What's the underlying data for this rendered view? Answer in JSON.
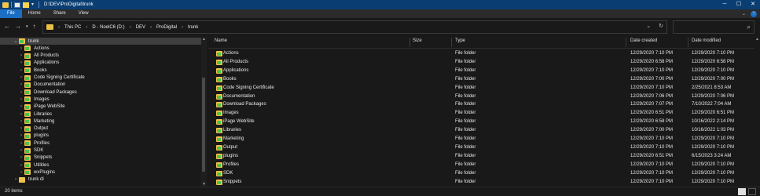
{
  "window": {
    "title": "D:\\DEV\\ProDigital\\trunk",
    "minimize": "─",
    "maximize": "☐",
    "close": "✕"
  },
  "ribbon": {
    "tabs": [
      "File",
      "Home",
      "Share",
      "View"
    ],
    "collapse_glyph": "⌄",
    "help_glyph": "?"
  },
  "address": {
    "crumbs": [
      "This PC",
      "D - NoelC6 (D:)",
      "DEV",
      "ProDigital",
      "trunk"
    ],
    "separator": "›",
    "search_placeholder": ""
  },
  "nav_tree": [
    {
      "label": "trunk",
      "indent": 0,
      "expanded": true,
      "selected": true
    },
    {
      "label": "Actions",
      "indent": 1
    },
    {
      "label": "All Products",
      "indent": 1
    },
    {
      "label": "Applications",
      "indent": 1
    },
    {
      "label": "Books",
      "indent": 1
    },
    {
      "label": "Code Signing Certificate",
      "indent": 1
    },
    {
      "label": "Documentation",
      "indent": 1
    },
    {
      "label": "Download Packages",
      "indent": 1
    },
    {
      "label": "Images",
      "indent": 1
    },
    {
      "label": "iPage WebSite",
      "indent": 1
    },
    {
      "label": "Libraries",
      "indent": 1
    },
    {
      "label": "Marketing",
      "indent": 1
    },
    {
      "label": "Output",
      "indent": 1
    },
    {
      "label": "plugins",
      "indent": 1
    },
    {
      "label": "Profiles",
      "indent": 1
    },
    {
      "label": "SDK",
      "indent": 1
    },
    {
      "label": "Snippets",
      "indent": 1
    },
    {
      "label": "Utilities",
      "indent": 1
    },
    {
      "label": "wxPlugins",
      "indent": 1
    },
    {
      "label": "trunk dl",
      "indent": 0,
      "plain": true
    }
  ],
  "columns": {
    "name": "Name",
    "size": "Size",
    "type": "Type",
    "created": "Date created",
    "modified": "Date modified"
  },
  "files": [
    {
      "name": "Actions",
      "type": "File folder",
      "created": "12/29/2020 7:10 PM",
      "modified": "12/29/2020 7:10 PM"
    },
    {
      "name": "All Products",
      "type": "File folder",
      "created": "12/29/2020 6:58 PM",
      "modified": "12/29/2020 6:58 PM"
    },
    {
      "name": "Applications",
      "type": "File folder",
      "created": "12/29/2020 7:10 PM",
      "modified": "12/29/2020 7:10 PM"
    },
    {
      "name": "Books",
      "type": "File folder",
      "created": "12/29/2020 7:00 PM",
      "modified": "12/29/2020 7:00 PM"
    },
    {
      "name": "Code Signing Certificate",
      "type": "File folder",
      "created": "12/29/2020 7:10 PM",
      "modified": "2/25/2021 8:53 AM"
    },
    {
      "name": "Documentation",
      "type": "File folder",
      "created": "12/29/2020 7:06 PM",
      "modified": "12/29/2020 7:06 PM"
    },
    {
      "name": "Download Packages",
      "type": "File folder",
      "created": "12/29/2020 7:07 PM",
      "modified": "7/10/2022 7:04 AM"
    },
    {
      "name": "Images",
      "type": "File folder",
      "created": "12/29/2020 6:51 PM",
      "modified": "12/29/2020 6:51 PM"
    },
    {
      "name": "iPage WebSite",
      "type": "File folder",
      "created": "12/29/2020 6:58 PM",
      "modified": "10/16/2022 2:14 PM"
    },
    {
      "name": "Libraries",
      "type": "File folder",
      "created": "12/29/2020 7:00 PM",
      "modified": "10/16/2022 1:03 PM"
    },
    {
      "name": "Marketing",
      "type": "File folder",
      "created": "12/29/2020 7:10 PM",
      "modified": "12/29/2020 7:10 PM"
    },
    {
      "name": "Output",
      "type": "File folder",
      "created": "12/29/2020 7:10 PM",
      "modified": "12/29/2020 7:10 PM"
    },
    {
      "name": "plugins",
      "type": "File folder",
      "created": "12/29/2020 6:51 PM",
      "modified": "6/15/2023 3:24 AM"
    },
    {
      "name": "Profiles",
      "type": "File folder",
      "created": "12/29/2020 7:10 PM",
      "modified": "12/29/2020 7:10 PM"
    },
    {
      "name": "SDK",
      "type": "File folder",
      "created": "12/29/2020 7:10 PM",
      "modified": "12/29/2020 7:10 PM"
    },
    {
      "name": "Snippets",
      "type": "File folder",
      "created": "12/29/2020 7:10 PM",
      "modified": "12/29/2020 7:10 PM"
    }
  ],
  "status": {
    "item_count": "20 items"
  },
  "colors": {
    "titlebar": "#0a3e72",
    "file_tab": "#1a6fc4",
    "folder": "#f0c24b",
    "folder_badge": "#4fc24b",
    "background": "#191919"
  }
}
